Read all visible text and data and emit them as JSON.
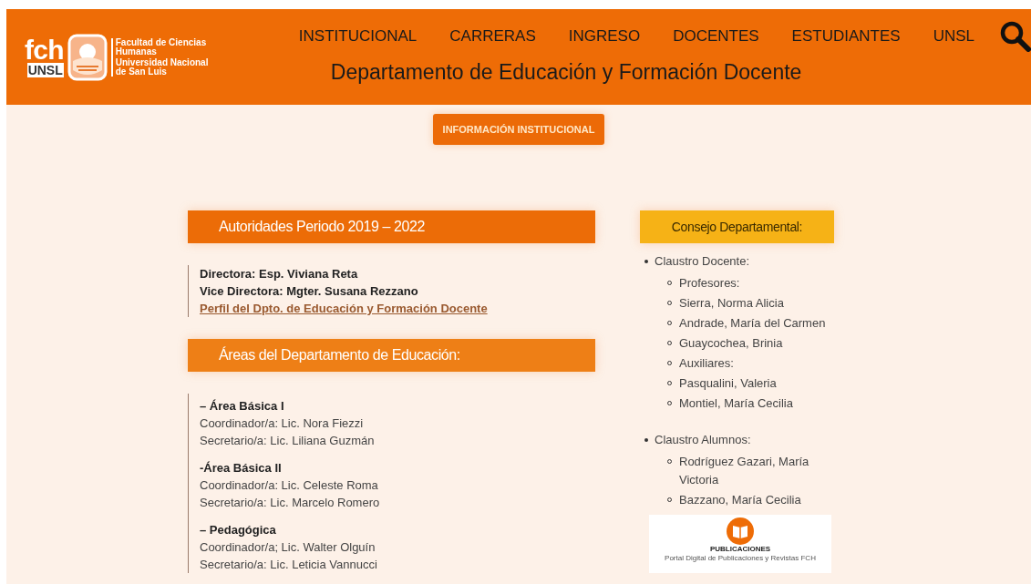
{
  "logo": {
    "mark_top": "fch",
    "mark_bottom": "UNSL",
    "faculty": "Facultad de Ciencias Humanas",
    "university": "Universidad Nacional de San Luis"
  },
  "nav": [
    "INSTITUCIONAL",
    "CARRERAS",
    "INGRESO",
    "DOCENTES",
    "ESTUDIANTES",
    "UNSL"
  ],
  "page_title": "Departamento de Educación y Formación Docente",
  "info_button": "INFORMACIÓN INSTITUCIONAL",
  "authorities": {
    "heading": "Autoridades Periodo 2019 – 2022",
    "lines": [
      "Directora: Esp. Viviana Reta",
      "Vice Directora: Mgter. Susana Rezzano"
    ],
    "link": "Perfil del Dpto. de Educación y Formación Docente"
  },
  "areas": {
    "heading": "Áreas del Departamento de Educación:",
    "items": [
      {
        "title": "– Área Básica I",
        "lines": [
          "Coordinador/a: Lic. Nora Fiezzi",
          "Secretario/a: Lic. Liliana Guzmán"
        ]
      },
      {
        "title": "-Área Básica II",
        "lines": [
          "Coordinador/a: Lic. Celeste Roma",
          "Secretario/a: Lic. Marcelo Romero"
        ]
      },
      {
        "title": "– Pedagógica",
        "lines": [
          "Coordinador/a; Lic. Walter Olguín",
          "Secretario/a: Lic. Leticia Vannucci"
        ]
      }
    ]
  },
  "council": {
    "heading": "Consejo Departamental:",
    "items": [
      {
        "label": "Claustro Docente:",
        "children": [
          "Profesores:",
          "Sierra, Norma Alicia",
          "Andrade, María del Carmen",
          "Guaycochea, Brinia",
          "Auxiliares:",
          "Pasqualini, Valeria",
          "Montiel, María Cecilia"
        ]
      },
      {
        "label": "Claustro Alumnos:",
        "children": [
          "Rodríguez Gazari, María Victoria",
          "Bazzano, María Cecilia"
        ]
      }
    ]
  },
  "publications_banner": {
    "title": "PUBLICACIONES",
    "subtitle": "Portal Digital de Publicaciones y Revistas FCH"
  }
}
